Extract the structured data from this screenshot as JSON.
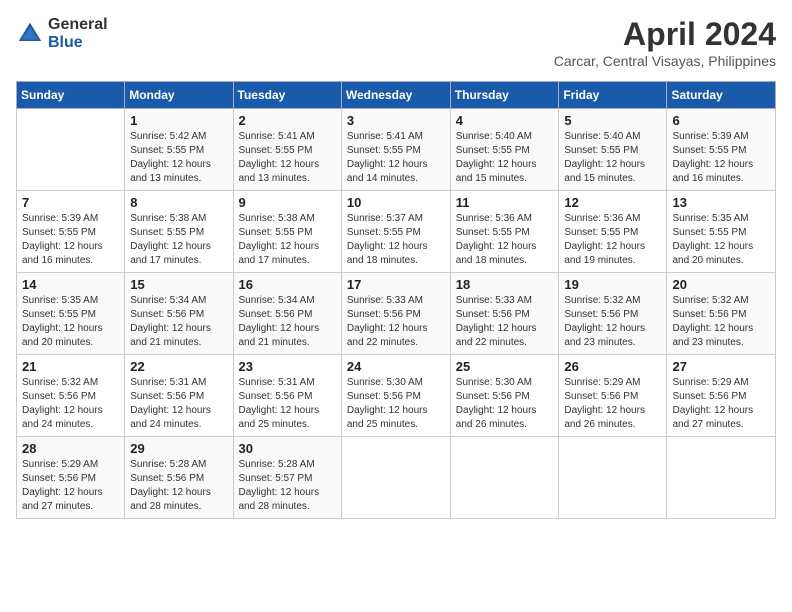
{
  "logo": {
    "general": "General",
    "blue": "Blue"
  },
  "title": "April 2024",
  "subtitle": "Carcar, Central Visayas, Philippines",
  "days_of_week": [
    "Sunday",
    "Monday",
    "Tuesday",
    "Wednesday",
    "Thursday",
    "Friday",
    "Saturday"
  ],
  "weeks": [
    [
      {
        "day": "",
        "info": ""
      },
      {
        "day": "1",
        "info": "Sunrise: 5:42 AM\nSunset: 5:55 PM\nDaylight: 12 hours\nand 13 minutes."
      },
      {
        "day": "2",
        "info": "Sunrise: 5:41 AM\nSunset: 5:55 PM\nDaylight: 12 hours\nand 13 minutes."
      },
      {
        "day": "3",
        "info": "Sunrise: 5:41 AM\nSunset: 5:55 PM\nDaylight: 12 hours\nand 14 minutes."
      },
      {
        "day": "4",
        "info": "Sunrise: 5:40 AM\nSunset: 5:55 PM\nDaylight: 12 hours\nand 15 minutes."
      },
      {
        "day": "5",
        "info": "Sunrise: 5:40 AM\nSunset: 5:55 PM\nDaylight: 12 hours\nand 15 minutes."
      },
      {
        "day": "6",
        "info": "Sunrise: 5:39 AM\nSunset: 5:55 PM\nDaylight: 12 hours\nand 16 minutes."
      }
    ],
    [
      {
        "day": "7",
        "info": "Sunrise: 5:39 AM\nSunset: 5:55 PM\nDaylight: 12 hours\nand 16 minutes."
      },
      {
        "day": "8",
        "info": "Sunrise: 5:38 AM\nSunset: 5:55 PM\nDaylight: 12 hours\nand 17 minutes."
      },
      {
        "day": "9",
        "info": "Sunrise: 5:38 AM\nSunset: 5:55 PM\nDaylight: 12 hours\nand 17 minutes."
      },
      {
        "day": "10",
        "info": "Sunrise: 5:37 AM\nSunset: 5:55 PM\nDaylight: 12 hours\nand 18 minutes."
      },
      {
        "day": "11",
        "info": "Sunrise: 5:36 AM\nSunset: 5:55 PM\nDaylight: 12 hours\nand 18 minutes."
      },
      {
        "day": "12",
        "info": "Sunrise: 5:36 AM\nSunset: 5:55 PM\nDaylight: 12 hours\nand 19 minutes."
      },
      {
        "day": "13",
        "info": "Sunrise: 5:35 AM\nSunset: 5:55 PM\nDaylight: 12 hours\nand 20 minutes."
      }
    ],
    [
      {
        "day": "14",
        "info": "Sunrise: 5:35 AM\nSunset: 5:55 PM\nDaylight: 12 hours\nand 20 minutes."
      },
      {
        "day": "15",
        "info": "Sunrise: 5:34 AM\nSunset: 5:56 PM\nDaylight: 12 hours\nand 21 minutes."
      },
      {
        "day": "16",
        "info": "Sunrise: 5:34 AM\nSunset: 5:56 PM\nDaylight: 12 hours\nand 21 minutes."
      },
      {
        "day": "17",
        "info": "Sunrise: 5:33 AM\nSunset: 5:56 PM\nDaylight: 12 hours\nand 22 minutes."
      },
      {
        "day": "18",
        "info": "Sunrise: 5:33 AM\nSunset: 5:56 PM\nDaylight: 12 hours\nand 22 minutes."
      },
      {
        "day": "19",
        "info": "Sunrise: 5:32 AM\nSunset: 5:56 PM\nDaylight: 12 hours\nand 23 minutes."
      },
      {
        "day": "20",
        "info": "Sunrise: 5:32 AM\nSunset: 5:56 PM\nDaylight: 12 hours\nand 23 minutes."
      }
    ],
    [
      {
        "day": "21",
        "info": "Sunrise: 5:32 AM\nSunset: 5:56 PM\nDaylight: 12 hours\nand 24 minutes."
      },
      {
        "day": "22",
        "info": "Sunrise: 5:31 AM\nSunset: 5:56 PM\nDaylight: 12 hours\nand 24 minutes."
      },
      {
        "day": "23",
        "info": "Sunrise: 5:31 AM\nSunset: 5:56 PM\nDaylight: 12 hours\nand 25 minutes."
      },
      {
        "day": "24",
        "info": "Sunrise: 5:30 AM\nSunset: 5:56 PM\nDaylight: 12 hours\nand 25 minutes."
      },
      {
        "day": "25",
        "info": "Sunrise: 5:30 AM\nSunset: 5:56 PM\nDaylight: 12 hours\nand 26 minutes."
      },
      {
        "day": "26",
        "info": "Sunrise: 5:29 AM\nSunset: 5:56 PM\nDaylight: 12 hours\nand 26 minutes."
      },
      {
        "day": "27",
        "info": "Sunrise: 5:29 AM\nSunset: 5:56 PM\nDaylight: 12 hours\nand 27 minutes."
      }
    ],
    [
      {
        "day": "28",
        "info": "Sunrise: 5:29 AM\nSunset: 5:56 PM\nDaylight: 12 hours\nand 27 minutes."
      },
      {
        "day": "29",
        "info": "Sunrise: 5:28 AM\nSunset: 5:56 PM\nDaylight: 12 hours\nand 28 minutes."
      },
      {
        "day": "30",
        "info": "Sunrise: 5:28 AM\nSunset: 5:57 PM\nDaylight: 12 hours\nand 28 minutes."
      },
      {
        "day": "",
        "info": ""
      },
      {
        "day": "",
        "info": ""
      },
      {
        "day": "",
        "info": ""
      },
      {
        "day": "",
        "info": ""
      }
    ]
  ]
}
